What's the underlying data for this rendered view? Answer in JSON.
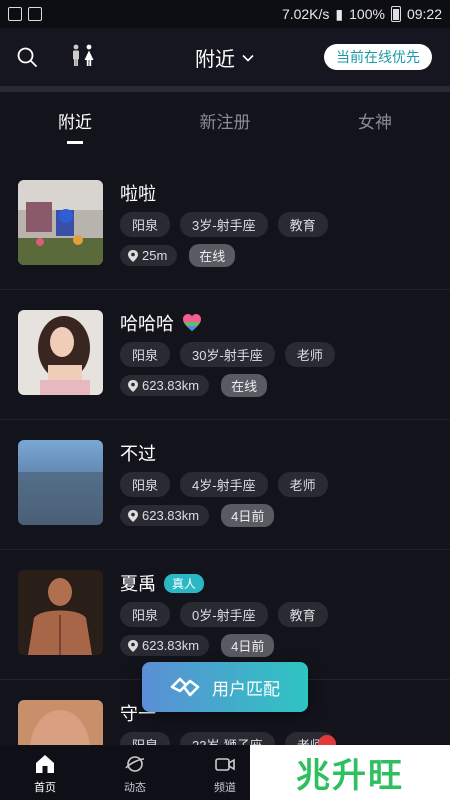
{
  "status_bar": {
    "speed": "7.02K/s",
    "battery": "100%",
    "time": "09:22"
  },
  "header": {
    "title": "附近",
    "online_button": "当前在线优先"
  },
  "tabs": [
    {
      "label": "附近",
      "active": true
    },
    {
      "label": "新注册",
      "active": false
    },
    {
      "label": "女神",
      "active": false
    }
  ],
  "users": [
    {
      "name": "啦啦",
      "badge": "",
      "tags": [
        "阳泉",
        "3岁-射手座",
        "教育"
      ],
      "distance": "25m",
      "status": "在线"
    },
    {
      "name": "哈哈哈",
      "badge": "heart",
      "tags": [
        "阳泉",
        "30岁-射手座",
        "老师"
      ],
      "distance": "623.83km",
      "status": "在线"
    },
    {
      "name": "不过",
      "badge": "",
      "tags": [
        "阳泉",
        "4岁-射手座",
        "老师"
      ],
      "distance": "623.83km",
      "status": "4日前"
    },
    {
      "name": "夏禹",
      "badge": "真人",
      "tags": [
        "阳泉",
        "0岁-射手座",
        "教育"
      ],
      "distance": "623.83km",
      "status": "4日前"
    },
    {
      "name": "守一",
      "badge": "",
      "tags": [
        "阳泉",
        "23岁-狮子座",
        "老师"
      ],
      "distance": "",
      "status": ""
    }
  ],
  "match_button": "用户匹配",
  "bottom_nav": [
    {
      "label": "首页",
      "icon": "home-icon",
      "active": true
    },
    {
      "label": "动态",
      "icon": "planet-icon",
      "active": false
    },
    {
      "label": "频道",
      "icon": "video-icon",
      "active": false
    }
  ],
  "watermark": "兆升旺",
  "colors": {
    "accent": "#2bb8c5",
    "background": "#13131c"
  }
}
